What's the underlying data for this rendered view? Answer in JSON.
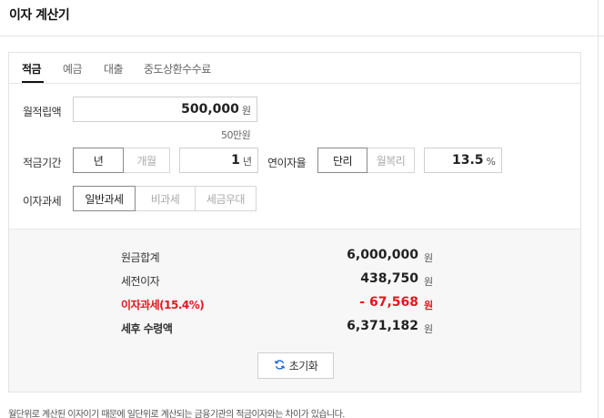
{
  "header": {
    "title": "이자 계산기"
  },
  "tabs": [
    {
      "label": "적금",
      "active": true
    },
    {
      "label": "예금",
      "active": false
    },
    {
      "label": "대출",
      "active": false
    },
    {
      "label": "중도상환수수료",
      "active": false
    }
  ],
  "form": {
    "deposit": {
      "label": "월적립액",
      "value": "500,000",
      "unit": "원",
      "hint": "50만원"
    },
    "period": {
      "label": "적금기간",
      "options": [
        {
          "label": "년",
          "selected": true
        },
        {
          "label": "개월",
          "selected": false
        }
      ],
      "value": "1",
      "unit": "년"
    },
    "rate": {
      "label": "연이자율",
      "options": [
        {
          "label": "단리",
          "selected": true
        },
        {
          "label": "월복리",
          "selected": false
        }
      ],
      "value": "13.5",
      "unit": "%"
    },
    "tax": {
      "label": "이자과세",
      "options": [
        {
          "label": "일반과세",
          "selected": true
        },
        {
          "label": "비과세",
          "selected": false
        },
        {
          "label": "세금우대",
          "selected": false
        }
      ]
    }
  },
  "result": {
    "rows": [
      {
        "label": "원금합계",
        "value": "6,000,000",
        "unit": "원"
      },
      {
        "label": "세전이자",
        "value": "438,750",
        "unit": "원"
      },
      {
        "label": "이자과세(15.4%)",
        "value": "- 67,568",
        "unit": "원"
      },
      {
        "label": "세후 수령액",
        "value": "6,371,182",
        "unit": "원"
      }
    ],
    "reset_label": "초기화"
  },
  "footnote": "월단위로 계산된 이자이기 때문에 일단위로 계산되는 금융기관의 적금이자와는 차이가 있습니다.",
  "colors": {
    "accent_red": "#e4161f",
    "reset_icon": "#1a64d6"
  }
}
